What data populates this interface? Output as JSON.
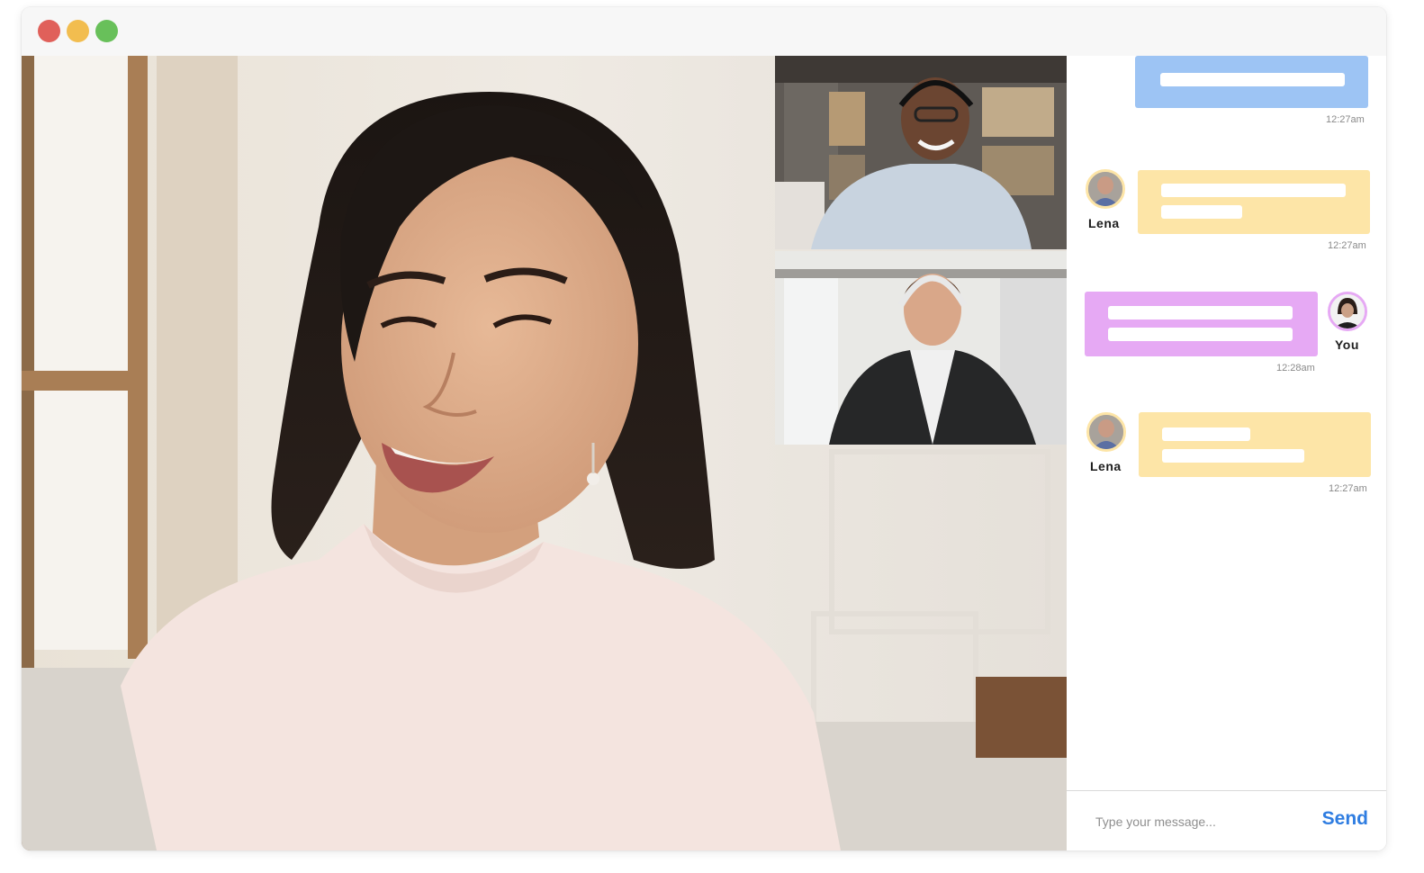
{
  "window": {
    "controls": [
      {
        "name": "close",
        "color": "#e0605a"
      },
      {
        "name": "minimize",
        "color": "#f2bd4f"
      },
      {
        "name": "zoom",
        "color": "#68c05a"
      }
    ]
  },
  "video": {
    "main_participant": "main-video-feed",
    "tiles": [
      "participant-video-tile",
      "participant-video-tile"
    ]
  },
  "chat": {
    "messages": [
      {
        "sender": "",
        "time": "12:27am",
        "color": "#9dc4f4"
      },
      {
        "sender": "Lena",
        "time": "12:27am",
        "color": "#fde5a7"
      },
      {
        "sender": "You",
        "time": "12:28am",
        "color": "#e6a9f4"
      },
      {
        "sender": "Lena",
        "time": "12:27am",
        "color": "#fde5a7"
      }
    ],
    "composer": {
      "placeholder": "Type your message...",
      "send_label": "Send"
    }
  }
}
